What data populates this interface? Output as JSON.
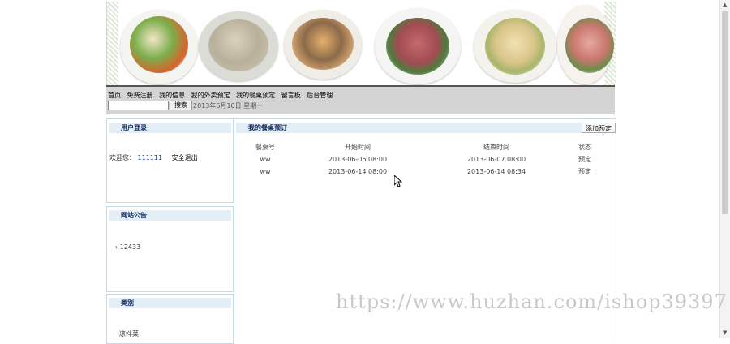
{
  "nav": {
    "items": [
      "首页",
      "免费注册",
      "我的信息",
      "我的外卖预定",
      "我的餐桌预定",
      "留言板",
      "后台管理"
    ]
  },
  "search": {
    "button_label": "搜索",
    "placeholder": ""
  },
  "date_text": "2013年6月10日 星期一",
  "login_box": {
    "title": "用户登录",
    "welcome": "欢迎您：",
    "username": "111111",
    "logout": "安全退出"
  },
  "notice_box": {
    "title": "网站公告",
    "items": [
      "12433"
    ]
  },
  "category_box": {
    "title": "类别",
    "items": [
      "凉拌菜"
    ]
  },
  "main": {
    "title": "我的餐桌预订",
    "add_button": "添加预定",
    "columns": [
      "餐桌号",
      "开始时间",
      "结束时间",
      "状态"
    ],
    "rows": [
      [
        "ww",
        "2013-06-06 08:00",
        "2013-06-07 08:00",
        "预定"
      ],
      [
        "ww",
        "2013-06-14 08:00",
        "2013-06-14 08:34",
        "预定"
      ]
    ]
  },
  "watermark": "https://www.huzhan.com/ishop39397",
  "colors": {
    "box_header_bg": "#e4eef7",
    "box_header_text": "#0d2a5c",
    "nav_bg": "#d4d4d4"
  }
}
